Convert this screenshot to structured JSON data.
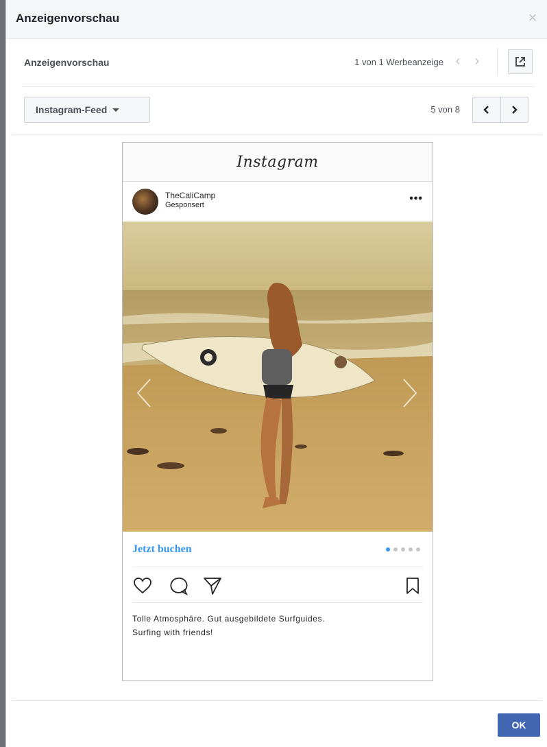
{
  "dialog": {
    "title": "Anzeigenvorschau",
    "close_glyph": "×"
  },
  "preview_header": {
    "title": "Anzeigenvorschau",
    "ad_count": "1 von 1 Werbeanzeige",
    "prev_glyph": "‹",
    "next_glyph": "›",
    "external_icon": "external-link-icon"
  },
  "placement": {
    "selected": "Instagram-Feed",
    "count": "5 von 8",
    "prev_icon": "chevron-left-icon",
    "next_icon": "chevron-right-icon"
  },
  "instagram_post": {
    "logo": "Instagram",
    "account_name": "TheCaliCamp",
    "sponsored": "Gesponsert",
    "more_glyph": "•••",
    "cta_label": "Jetzt buchen",
    "carousel": {
      "total": 5,
      "active_index": 0
    },
    "caption_line1": "Tolle Atmosphäre. Gut ausgebildete Surfguides.",
    "caption_line2": "Surfing with friends!",
    "actions": [
      "heart-icon",
      "comment-icon",
      "share-icon",
      "bookmark-icon"
    ]
  },
  "footer": {
    "ok_label": "OK"
  },
  "colors": {
    "primary_button": "#4267b2",
    "instagram_link": "#3897f0"
  }
}
